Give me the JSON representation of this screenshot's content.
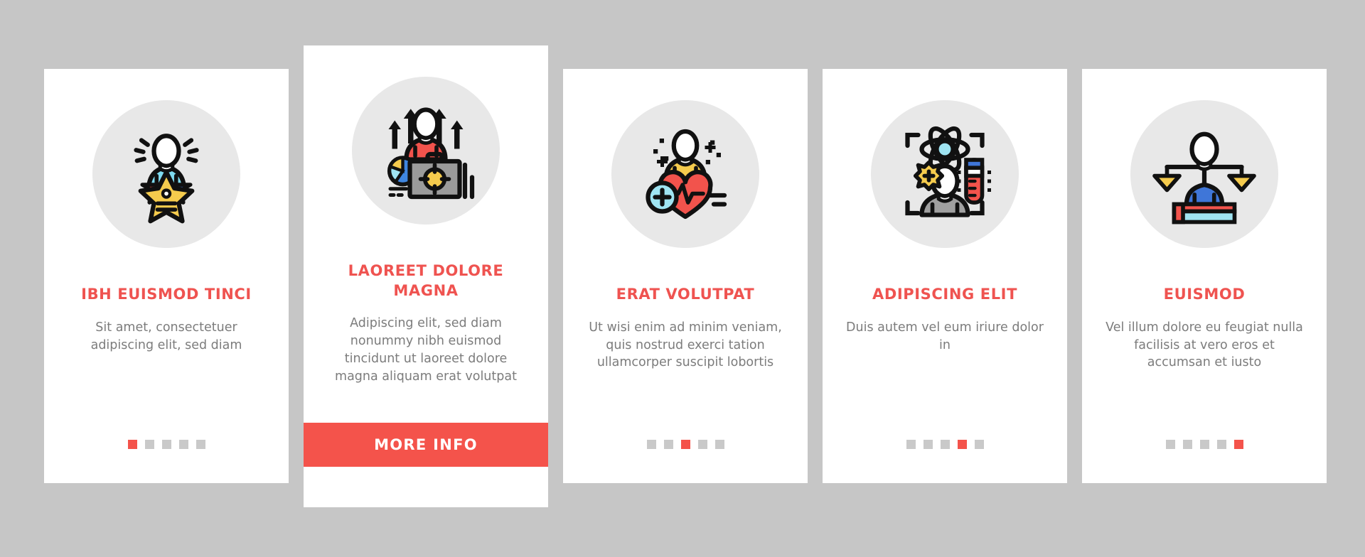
{
  "page": {
    "background_color": "#c6c6c6",
    "card_background": "#ffffff",
    "accent_color": "#ef5350",
    "cta_color": "#f4534b",
    "body_text_color": "#7c7c7c",
    "dot_inactive_color": "#c9c9c9",
    "icon_circle_color": "#e8e8e8"
  },
  "cards": [
    {
      "icon_name": "person-with-stars-award-icon",
      "title": "IBH EUISMOD TINCI",
      "description": "Sit amet, consectetuer adipiscing elit, sed diam",
      "dots": {
        "count": 5,
        "active_index": 0
      },
      "featured": false
    },
    {
      "icon_name": "person-with-briefcase-growth-icon",
      "title": "LAOREET DOLORE MAGNA",
      "description": "Adipiscing elit, sed diam nonummy nibh euismod tincidunt ut laoreet dolore magna aliquam erat volutpat",
      "cta_label": "MORE INFO",
      "featured": true
    },
    {
      "icon_name": "person-with-heart-health-icon",
      "title": "ERAT VOLUTPAT",
      "description": "Ut wisi enim ad minim veniam, quis nostrud exerci tation ullamcorper suscipit lobortis",
      "dots": {
        "count": 5,
        "active_index": 2
      },
      "featured": false
    },
    {
      "icon_name": "person-with-atom-science-icon",
      "title": "ADIPISCING ELIT",
      "description": "Duis autem vel eum iriure dolor in",
      "dots": {
        "count": 5,
        "active_index": 3
      },
      "featured": false
    },
    {
      "icon_name": "person-with-scales-justice-icon",
      "title": "EUISMOD",
      "description": "Vel illum dolore eu feugiat nulla facilisis at vero eros et accumsan et iusto",
      "dots": {
        "count": 5,
        "active_index": 4
      },
      "featured": false
    }
  ]
}
